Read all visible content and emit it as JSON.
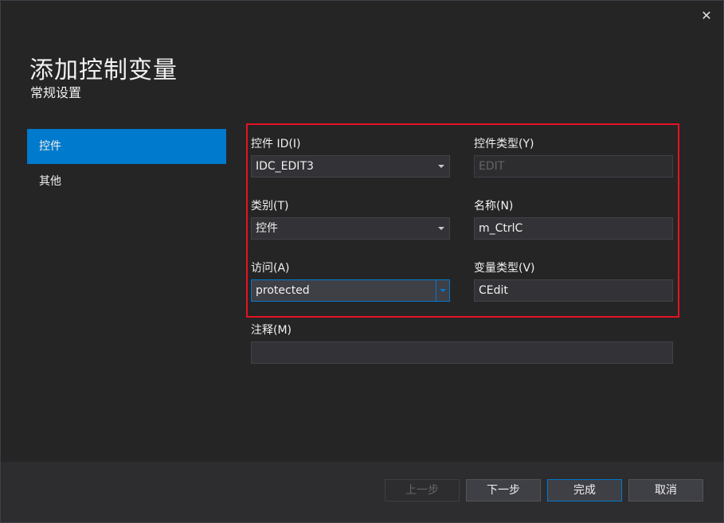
{
  "dialog": {
    "title": "添加控制变量",
    "subtitle": "常规设置",
    "close_glyph": "✕"
  },
  "nav": {
    "items": [
      {
        "label": "控件",
        "active": true
      },
      {
        "label": "其他",
        "active": false
      }
    ]
  },
  "form": {
    "control_id": {
      "label": "控件 ID(I)",
      "value": "IDC_EDIT3"
    },
    "control_type": {
      "label": "控件类型(Y)",
      "value": "EDIT"
    },
    "category": {
      "label": "类别(T)",
      "value": "控件"
    },
    "name": {
      "label": "名称(N)",
      "value": "m_CtrlC"
    },
    "access": {
      "label": "访问(A)",
      "value": "protected"
    },
    "variable_type": {
      "label": "变量类型(V)",
      "value": "CEdit"
    },
    "comment": {
      "label": "注释(M)",
      "value": ""
    }
  },
  "footer": {
    "prev_label": "上一步",
    "next_label": "下一步",
    "finish_label": "完成",
    "cancel_label": "取消"
  },
  "colors": {
    "accent": "#007acc",
    "highlight_border": "#e81123",
    "background": "#252526"
  }
}
